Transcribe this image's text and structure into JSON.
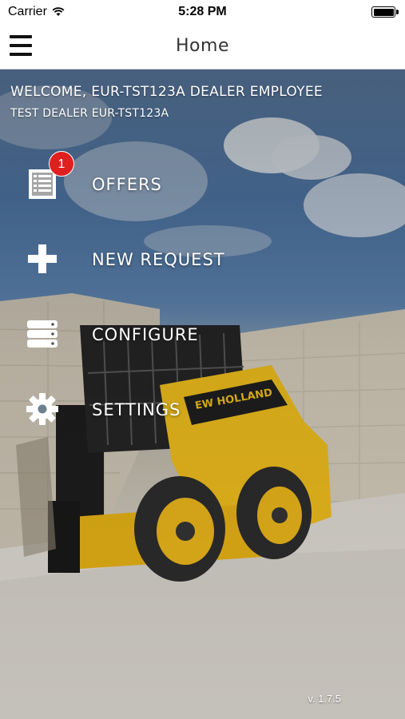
{
  "status_bar": {
    "carrier": "Carrier",
    "time": "5:28 PM"
  },
  "nav": {
    "title": "Home",
    "menu_icon": "hamburger-icon"
  },
  "welcome": {
    "line1": "WELCOME, EUR-TST123A DEALER EMPLOYEE",
    "line2": "TEST DEALER EUR-TST123A"
  },
  "menu": {
    "items": [
      {
        "label": "OFFERS",
        "icon": "document-list-icon",
        "badge": "1"
      },
      {
        "label": "NEW REQUEST",
        "icon": "plus-icon"
      },
      {
        "label": "CONFIGURE",
        "icon": "server-stack-icon"
      },
      {
        "label": "SETTINGS",
        "icon": "gear-icon"
      }
    ]
  },
  "footer": {
    "version": "v. 1.7.5"
  },
  "colors": {
    "badge": "#e0201f",
    "menu_text": "#ffffff",
    "machine_yellow": "#e8b81c"
  }
}
